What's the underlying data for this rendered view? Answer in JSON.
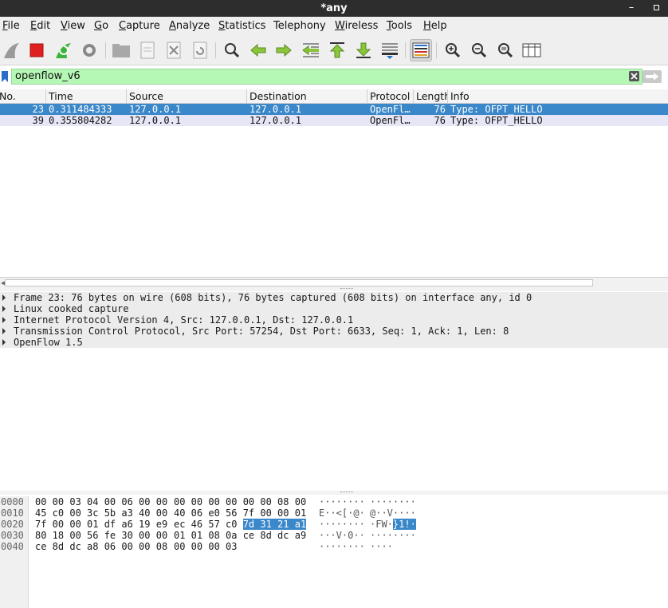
{
  "window": {
    "title": "*any",
    "minimize_glyph": "–"
  },
  "menu": [
    {
      "first": "F",
      "rest": "ile"
    },
    {
      "first": "E",
      "rest": "dit"
    },
    {
      "first": "V",
      "rest": "iew"
    },
    {
      "first": "G",
      "rest": "o"
    },
    {
      "first": "C",
      "rest": "apture"
    },
    {
      "first": "A",
      "rest": "nalyze"
    },
    {
      "first": "S",
      "rest": "tatistics"
    },
    {
      "first": "",
      "rest": "Telephony"
    },
    {
      "first": "W",
      "rest": "ireless"
    },
    {
      "first": "T",
      "rest": "ools"
    },
    {
      "first": "H",
      "rest": "elp"
    }
  ],
  "toolbar": {
    "icons": [
      "shark-fin-icon",
      "stop-icon",
      "restart-icon",
      "capture-options-icon",
      "open-file-icon",
      "save-file-icon",
      "close-file-icon",
      "reload-icon",
      "find-packet-icon",
      "go-back-icon",
      "go-forward-icon",
      "go-to-packet-icon",
      "first-packet-icon",
      "last-packet-icon",
      "autoscroll-icon",
      "colorize-icon",
      "zoom-in-icon",
      "zoom-out-icon",
      "zoom-normal-icon",
      "resize-columns-icon"
    ]
  },
  "filter": {
    "value": "openflow_v6",
    "color": "#b5f7b5"
  },
  "packet_list": {
    "columns": [
      "No.",
      "Time",
      "Source",
      "Destination",
      "Protocol",
      "Length",
      "Info"
    ],
    "rows": [
      {
        "no": "23",
        "time": "0.311484333",
        "source": "127.0.0.1",
        "destination": "127.0.0.1",
        "protocol": "OpenFl…",
        "length": "76",
        "info": "Type: OFPT_HELLO"
      },
      {
        "no": "39",
        "time": "0.355804282",
        "source": "127.0.0.1",
        "destination": "127.0.0.1",
        "protocol": "OpenFl…",
        "length": "76",
        "info": "Type: OFPT_HELLO"
      }
    ],
    "selected_color": "#3a87c9",
    "alt_color": "#e6e6f6"
  },
  "details": [
    "Frame 23: 76 bytes on wire (608 bits), 76 bytes captured (608 bits) on interface any, id 0",
    "Linux cooked capture",
    "Internet Protocol Version 4, Src: 127.0.0.1, Dst: 127.0.0.1",
    "Transmission Control Protocol, Src Port: 57254, Dst Port: 6633, Seq: 1, Ack: 1, Len: 8",
    "OpenFlow 1.5"
  ],
  "bytes": [
    {
      "offset": "0000",
      "hex1": "00 00 03 04 00 06 00 00",
      "hex2": "00 00 00 00 00 00 08 00",
      "hex2_hl": "",
      "ascii1": "········",
      "ascii2": "········",
      "ascii2_hl": ""
    },
    {
      "offset": "0010",
      "hex1": "45 c0 00 3c 5b a3 40 00",
      "hex2": "40 06 e0 56 7f 00 00 01",
      "hex2_hl": "",
      "ascii1": "E··<[·@·",
      "ascii2": "@··V····",
      "ascii2_hl": ""
    },
    {
      "offset": "0020",
      "hex1": "7f 00 00 01 df a6 19 e9",
      "hex2": "ec 46 57 c0 ",
      "hex2_hl": "7d 31 21 a1",
      "ascii1": "········",
      "ascii2": "·FW·",
      "ascii2_hl": "}1!·"
    },
    {
      "offset": "0030",
      "hex1": "80 18 00 56 fe 30 00 00",
      "hex2": "01 01 08 0a ce 8d dc a9",
      "hex2_hl": "",
      "ascii1": "···V·0··",
      "ascii2": "········",
      "ascii2_hl": ""
    },
    {
      "offset": "0040",
      "hex1": "ce 8d dc a8 06 00 00 08",
      "hex2": "00 00 00 03",
      "hex2_hl": "",
      "ascii1": "········",
      "ascii2": "····",
      "ascii2_hl": ""
    }
  ]
}
